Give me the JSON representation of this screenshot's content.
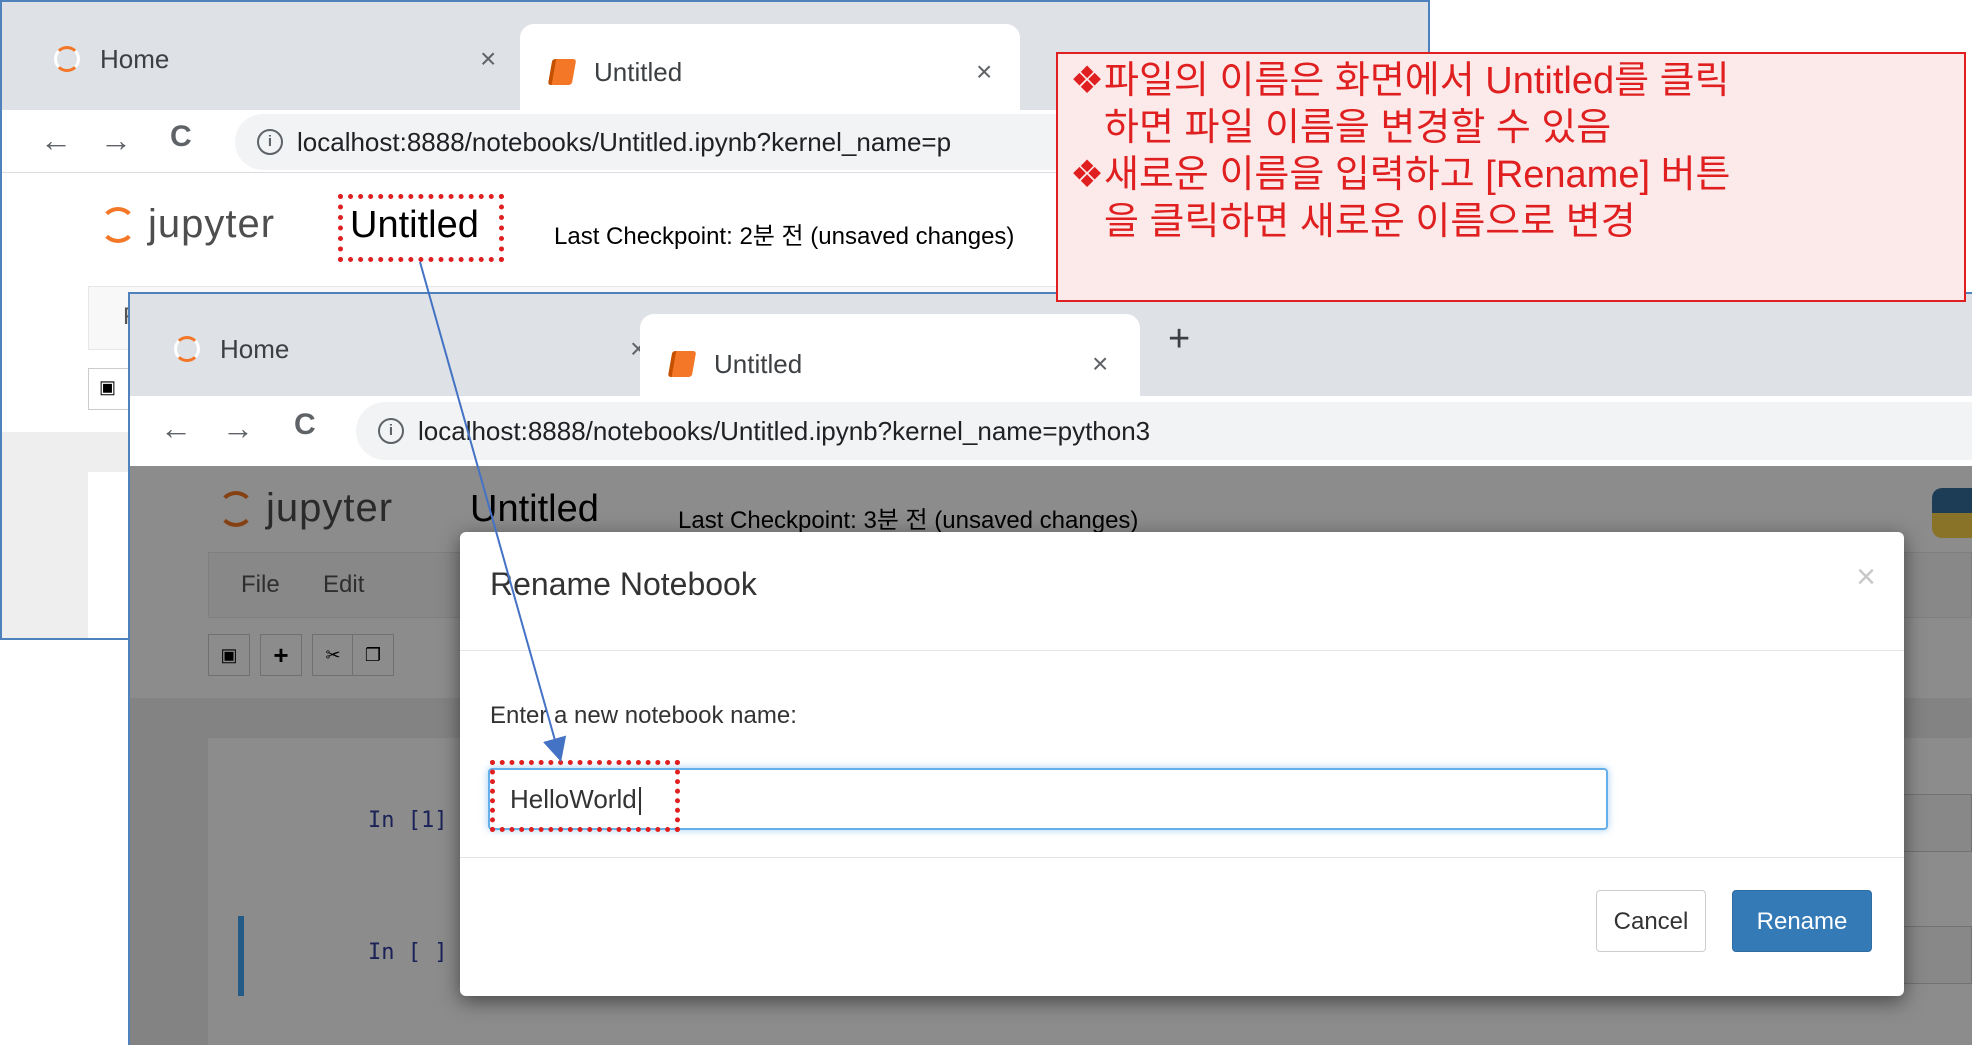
{
  "back_window": {
    "tabs": [
      {
        "label": "Home",
        "active": false
      },
      {
        "label": "Untitled",
        "active": true
      }
    ],
    "url": "localhost:8888/notebooks/Untitled.ipynb?kernel_name=p",
    "logo_text": "jupyter",
    "notebook_name": "Untitled",
    "checkpoint": "Last Checkpoint: 2분 전   (unsaved changes)",
    "menu_first_letter": "F"
  },
  "front_window": {
    "tabs": [
      {
        "label": "Home",
        "active": false
      },
      {
        "label": "Untitled",
        "active": true
      }
    ],
    "new_tab": "+",
    "url": "localhost:8888/notebooks/Untitled.ipynb?kernel_name=python3",
    "logo_text": "jupyter",
    "notebook_name": "Untitled",
    "checkpoint": "Last Checkpoint: 3분 전   (unsaved changes)",
    "menu": [
      "File",
      "Edit"
    ],
    "cells": [
      {
        "prompt": "In [1]"
      },
      {
        "prompt": "In [ ]"
      }
    ]
  },
  "dialog": {
    "title": "Rename Notebook",
    "close": "×",
    "label": "Enter a new notebook name:",
    "input_value": "HelloWorld",
    "cancel_label": "Cancel",
    "rename_label": "Rename"
  },
  "callout": {
    "bullet": "❖",
    "lines": [
      {
        "bullet": true,
        "text": "파일의 이름은 화면에서 Untitled를 클릭"
      },
      {
        "bullet": false,
        "text": "하면 파일 이름을 변경할 수 있음"
      },
      {
        "bullet": true,
        "text": "새로운 이름을 입력하고 [Rename] 버튼"
      },
      {
        "bullet": false,
        "text": "을 클릭하면 새로운 이름으로 변경"
      }
    ]
  },
  "colors": {
    "accent_red": "#e02020",
    "jupyter_orange": "#f37726",
    "primary_blue": "#337ab7"
  }
}
